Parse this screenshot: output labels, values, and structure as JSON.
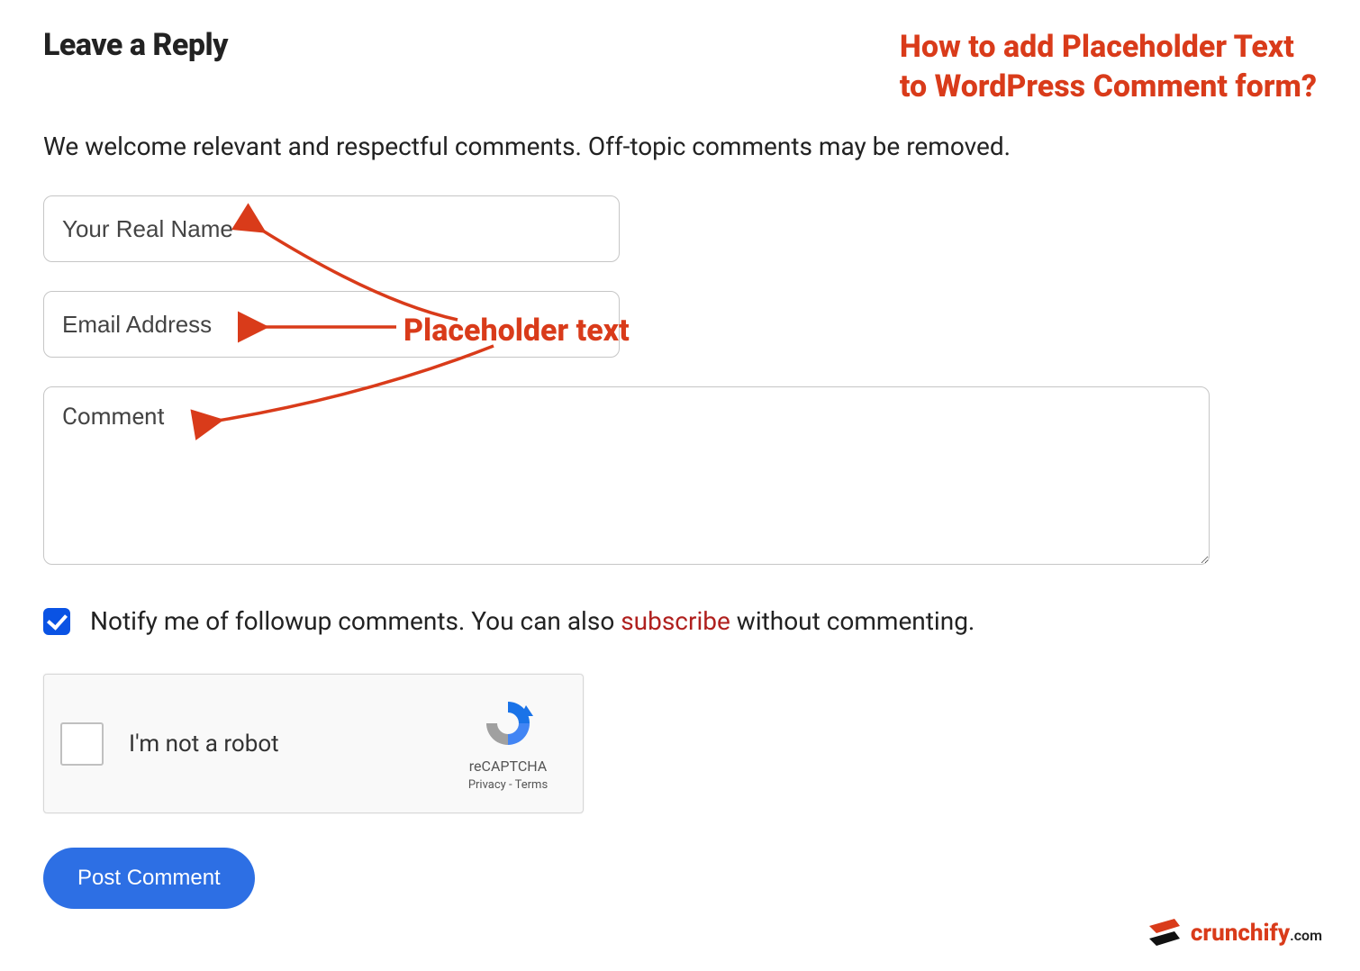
{
  "header": {
    "reply_title": "Leave a Reply",
    "article_title_line1": "How to add Placeholder Text",
    "article_title_line2": "to WordPress Comment form?"
  },
  "welcome": "We welcome relevant and respectful comments. Off-topic comments may be removed.",
  "form": {
    "name_placeholder": "Your Real Name",
    "email_placeholder": "Email Address",
    "comment_placeholder": "Comment"
  },
  "annotation": {
    "placeholder_label": "Placeholder text"
  },
  "notify": {
    "prefix": "Notify me of followup comments. You can also ",
    "link": "subscribe",
    "suffix": " without commenting."
  },
  "recaptcha": {
    "label": "I'm not a robot",
    "brand": "reCAPTCHA",
    "privacy": "Privacy",
    "terms": "Terms"
  },
  "submit_label": "Post Comment",
  "logo": {
    "name": "crunchify",
    "suffix": ".com"
  },
  "colors": {
    "accent": "#d93b1a",
    "button": "#2d6fe4",
    "checkbox": "#0a53e4"
  }
}
